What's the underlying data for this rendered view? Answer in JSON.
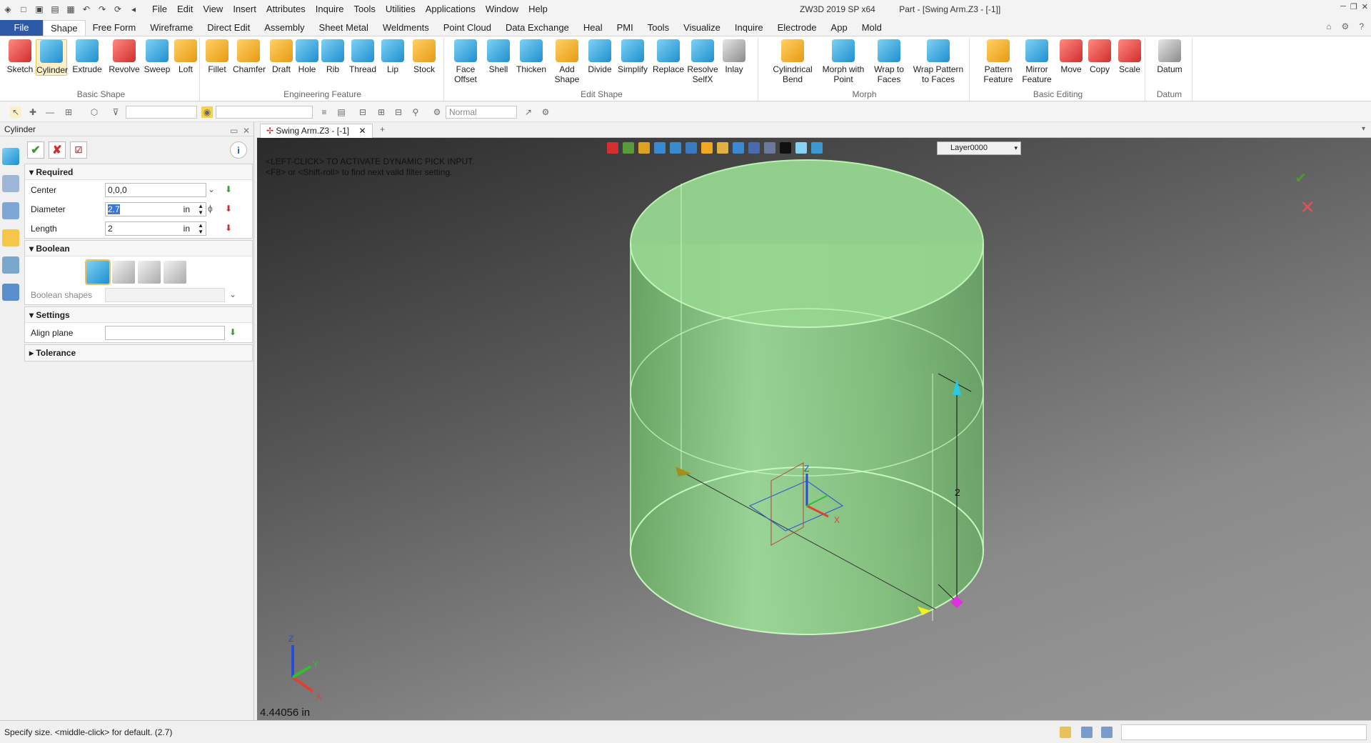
{
  "app": {
    "title": "ZW3D 2019 SP x64",
    "document_title": "Part - [Swing Arm.Z3 - [-1]]"
  },
  "menu": [
    "File",
    "Edit",
    "View",
    "Insert",
    "Attributes",
    "Inquire",
    "Tools",
    "Utilities",
    "Applications",
    "Window",
    "Help"
  ],
  "ribbon_tabs": [
    "File",
    "Shape",
    "Free Form",
    "Wireframe",
    "Direct Edit",
    "Assembly",
    "Sheet Metal",
    "Weldments",
    "Point Cloud",
    "Data Exchange",
    "Heal",
    "PMI",
    "Tools",
    "Visualize",
    "Inquire",
    "Electrode",
    "App",
    "Mold"
  ],
  "ribbon_groups": [
    {
      "label": "Basic Shape",
      "buttons": [
        "Sketch",
        "Cylinder",
        "Extrude",
        "Revolve",
        "Sweep",
        "Loft"
      ]
    },
    {
      "label": "Engineering Feature",
      "buttons": [
        "Fillet",
        "Chamfer",
        "Draft",
        "Hole",
        "Rib",
        "Thread",
        "Lip",
        "Stock"
      ]
    },
    {
      "label": "Edit Shape",
      "buttons": [
        "Face Offset",
        "Shell",
        "Thicken",
        "Add Shape",
        "Divide",
        "Simplify",
        "Replace",
        "Resolve SelfX",
        "Inlay"
      ]
    },
    {
      "label": "Morph",
      "buttons": [
        "Cylindrical Bend",
        "Morph with Point",
        "Wrap to Faces",
        "Wrap Pattern to Faces"
      ]
    },
    {
      "label": "Basic Editing",
      "buttons": [
        "Pattern Feature",
        "Mirror Feature",
        "Move",
        "Copy",
        "Scale"
      ]
    },
    {
      "label": "Datum",
      "buttons": [
        "Datum"
      ]
    }
  ],
  "toolbar2": {
    "render_mode": "Normal"
  },
  "panel": {
    "title": "Cylinder",
    "required": {
      "heading": "Required",
      "center_label": "Center",
      "center_value": "0,0,0",
      "diameter_label": "Diameter",
      "diameter_value": "2.7",
      "diameter_unit": "in",
      "length_label": "Length",
      "length_value": "2",
      "length_unit": "in"
    },
    "boolean": {
      "heading": "Boolean",
      "shapes_label": "Boolean shapes"
    },
    "settings": {
      "heading": "Settings",
      "align_label": "Align plane"
    },
    "tolerance": {
      "heading": "Tolerance"
    }
  },
  "doc_tab": "Swing Arm.Z3 - [-1]",
  "viewport": {
    "layer": "Layer0000",
    "message_line1": "<LEFT-CLICK> TO ACTIVATE DYNAMIC PICK INPUT.",
    "message_line2": "<F8> or <Shift-roll> to find next valid filter setting.",
    "dimension_label": "2",
    "coordinate_readout": "4.44056 in",
    "axis_x": "X",
    "axis_y": "Y",
    "axis_z": "Z"
  },
  "status": {
    "text": "Specify size.   <middle-click> for default. (2.7)"
  },
  "colors": {
    "cylinder_fill": "#8fd68a",
    "cylinder_edge": "#b8f5a8",
    "accent": "#2c5aa8"
  }
}
